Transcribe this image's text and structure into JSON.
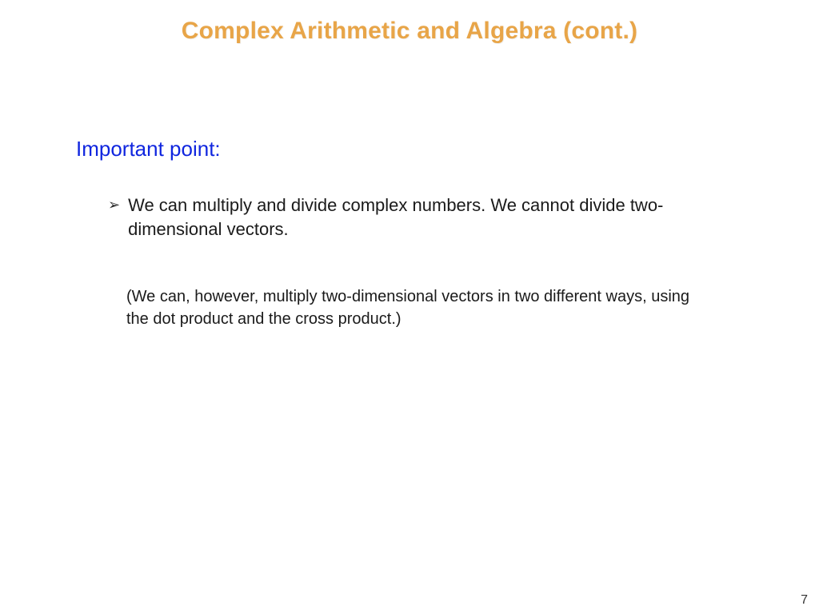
{
  "title": "Complex Arithmetic and Algebra (cont.)",
  "subtitle": "Important point:",
  "bullet": {
    "text": "We can multiply and divide complex numbers. We cannot divide two-dimensional vectors."
  },
  "note": "(We can, however, multiply two-dimensional vectors in two different ways, using the dot product and the cross product.)",
  "page_number": "7"
}
